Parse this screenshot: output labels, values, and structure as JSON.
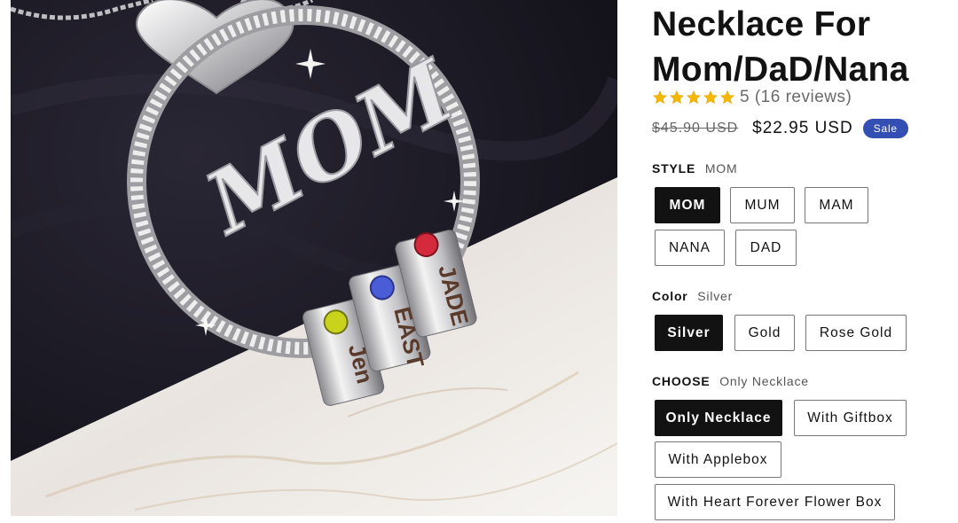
{
  "product": {
    "title": "Necklace For Mom/DaD/Nana",
    "rating": {
      "stars": 5,
      "text": "5 (16 reviews)",
      "star_color": "#f5b800"
    },
    "price": {
      "regular": "$45.90 USD",
      "sale": "$22.95 USD",
      "badge": "Sale",
      "badge_color": "#334fb4"
    },
    "image": {
      "pendant_text": "MOM",
      "bead_names": [
        "JADE",
        "EAST",
        "Jen"
      ],
      "stone_colors": [
        "#c9d31c",
        "#4a5cd6",
        "#d42a3c"
      ]
    }
  },
  "options": {
    "style": {
      "label": "STYLE",
      "value": "MOM",
      "choices": [
        "MOM",
        "MUM",
        "MAM",
        "NANA",
        "DAD"
      ],
      "selected": "MOM"
    },
    "color": {
      "label": "Color",
      "value": "Silver",
      "choices": [
        "Silver",
        "Gold",
        "Rose Gold"
      ],
      "selected": "Silver"
    },
    "choose": {
      "label": "CHOOSE",
      "value": "Only Necklace",
      "choices": [
        "Only Necklace",
        "With Giftbox",
        "With Applebox",
        "With Heart Forever Flower Box"
      ],
      "selected": "Only Necklace"
    }
  }
}
